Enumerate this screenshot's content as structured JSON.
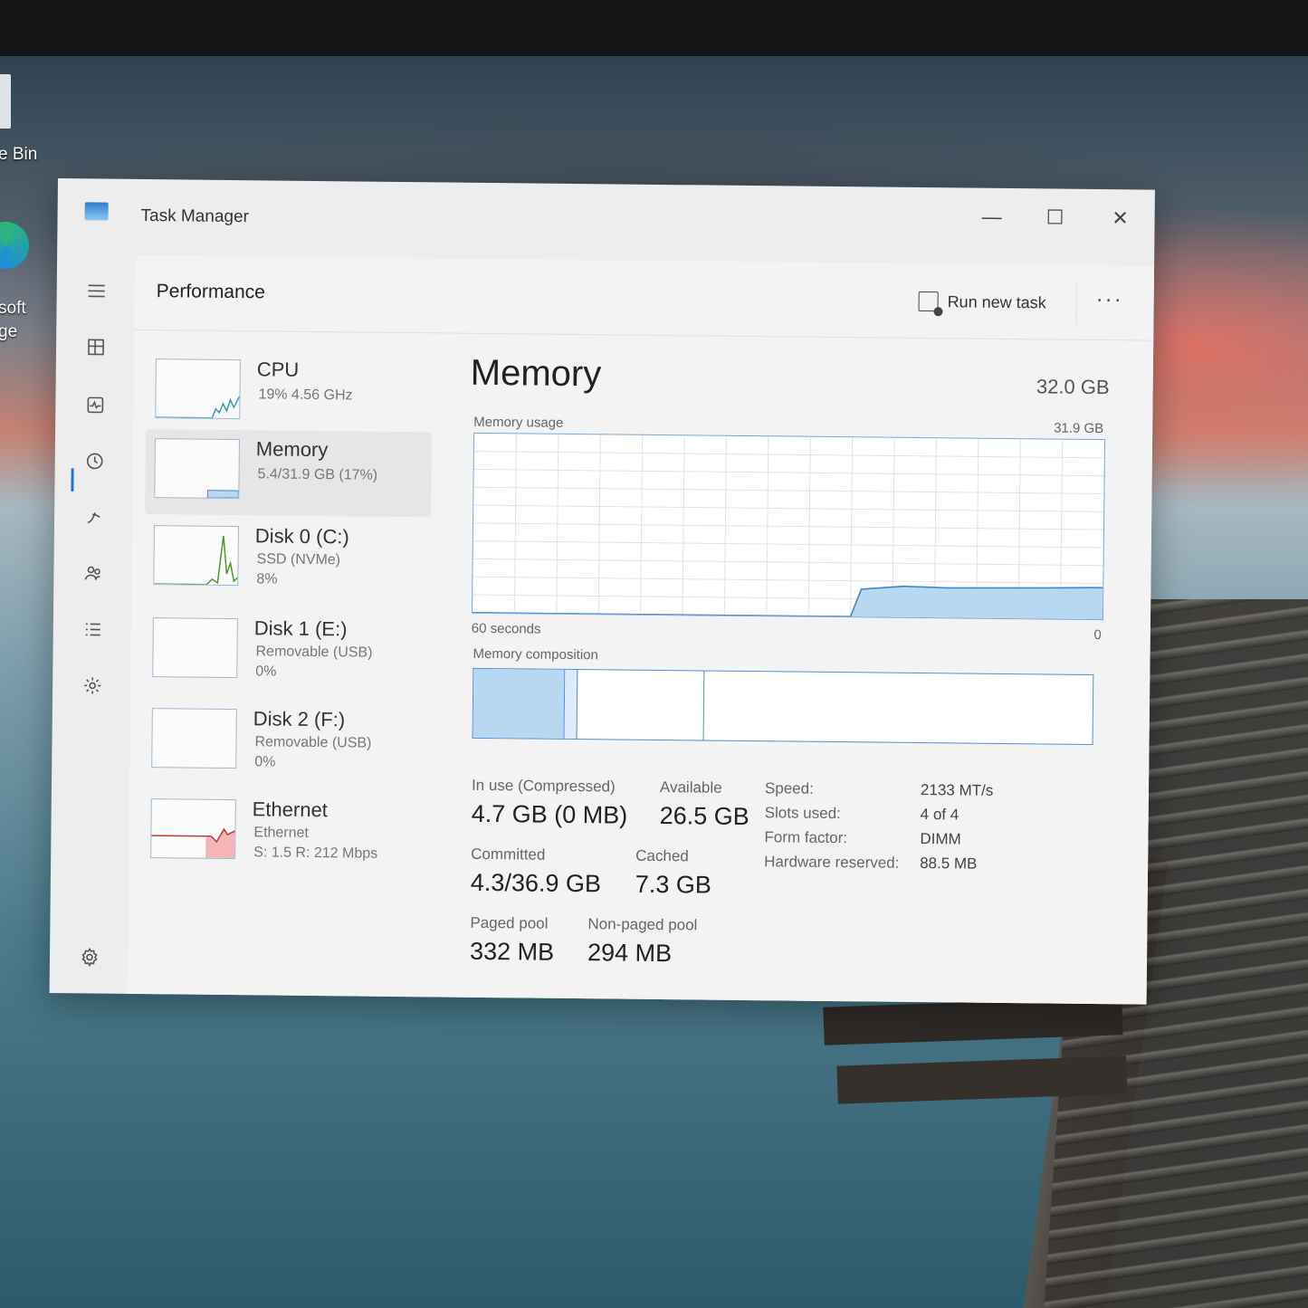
{
  "desktop": {
    "icons": [
      {
        "label": "e Bin"
      },
      {
        "label": "soft"
      },
      {
        "label": "ge"
      }
    ]
  },
  "window": {
    "title": "Task Manager",
    "controls": {
      "minimize": "—",
      "maximize": "☐",
      "close": "✕"
    }
  },
  "nav": {
    "items": [
      "hamburger-icon",
      "processes-icon",
      "performance-icon",
      "app-history-icon",
      "startup-apps-icon",
      "users-icon",
      "details-icon",
      "services-icon"
    ],
    "active": "performance-icon",
    "settings": "settings-icon"
  },
  "header": {
    "title": "Performance",
    "run_new_task": "Run new task",
    "more": "···"
  },
  "devices": [
    {
      "name": "CPU",
      "sub1": "19% 4.56 GHz",
      "sub2": "",
      "sub3": "",
      "usage_pct": 19
    },
    {
      "name": "Memory",
      "sub1": "5.4/31.9 GB (17%)",
      "sub2": "",
      "sub3": "",
      "usage_pct": 17
    },
    {
      "name": "Disk 0 (C:)",
      "sub1": "SSD (NVMe)",
      "sub2": "8%",
      "sub3": "",
      "usage_pct": 8
    },
    {
      "name": "Disk 1 (E:)",
      "sub1": "Removable (USB)",
      "sub2": "0%",
      "sub3": "",
      "usage_pct": 0
    },
    {
      "name": "Disk 2 (F:)",
      "sub1": "Removable (USB)",
      "sub2": "0%",
      "sub3": "",
      "usage_pct": 0
    },
    {
      "name": "Ethernet",
      "sub1": "Ethernet",
      "sub2": "S: 1.5 R: 212 Mbps",
      "sub3": ""
    }
  ],
  "memory": {
    "title": "Memory",
    "total": "32.0 GB",
    "usage_label": "Memory usage",
    "usage_max": "31.9 GB",
    "axis_left": "60 seconds",
    "axis_right": "0",
    "composition_label": "Memory composition",
    "composition": {
      "in_use_frac": 0.148,
      "modified_frac": 0.02,
      "standby_frac": 0.205
    },
    "stats": {
      "in_use_label": "In use (Compressed)",
      "in_use_value": "4.7 GB (0 MB)",
      "available_label": "Available",
      "available_value": "26.5 GB",
      "committed_label": "Committed",
      "committed_value": "4.3/36.9 GB",
      "cached_label": "Cached",
      "cached_value": "7.3 GB",
      "paged_label": "Paged pool",
      "paged_value": "332 MB",
      "nonpaged_label": "Non-paged pool",
      "nonpaged_value": "294 MB"
    },
    "specs": [
      {
        "label": "Speed:",
        "value": "2133 MT/s"
      },
      {
        "label": "Slots used:",
        "value": "4 of 4"
      },
      {
        "label": "Form factor:",
        "value": "DIMM"
      },
      {
        "label": "Hardware reserved:",
        "value": "88.5 MB"
      }
    ]
  },
  "chart_data": {
    "type": "area",
    "title": "",
    "xlabel": "60 seconds",
    "ylabel": "Memory usage",
    "xlim": [
      60,
      0
    ],
    "ylim": [
      0,
      31.9
    ],
    "series": [
      {
        "x": [
          60,
          24,
          23,
          19,
          15,
          10,
          5,
          1
        ],
        "values": [
          0,
          0,
          4.9,
          5.5,
          5.3,
          5.4,
          5.5,
          5.6
        ]
      }
    ],
    "grid": true
  },
  "colors": {
    "accent": "#1976d2",
    "memory_line": "#3f86d1",
    "memory_fill": "#b8d7f1",
    "cpu_line": "#3a96b4",
    "disk_line": "#4c9a2a",
    "ethernet_line": "#c0392b",
    "ethernet_fill": "#f3b5b5"
  }
}
